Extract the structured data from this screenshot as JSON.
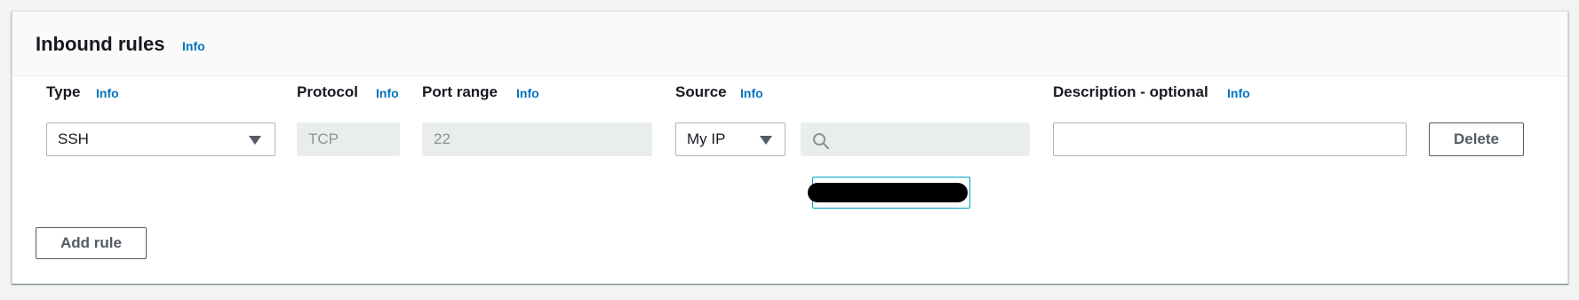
{
  "panel": {
    "title": "Inbound rules",
    "title_info": "Info"
  },
  "columns": {
    "type": {
      "label": "Type",
      "info": "Info"
    },
    "protocol": {
      "label": "Protocol",
      "info": "Info"
    },
    "port_range": {
      "label": "Port range",
      "info": "Info"
    },
    "source": {
      "label": "Source",
      "info": "Info"
    },
    "description": {
      "label": "Description - optional",
      "info": "Info"
    }
  },
  "rule": {
    "type_value": "SSH",
    "protocol_value": "TCP",
    "port_range_value": "22",
    "source_value": "My IP",
    "source_search_value": "",
    "source_chip": "",
    "description_value": ""
  },
  "buttons": {
    "delete": "Delete",
    "add_rule": "Add rule"
  },
  "icons": {
    "type_dropdown": "caret-down-icon",
    "source_dropdown": "caret-down-icon",
    "search": "search-icon"
  },
  "colors": {
    "info_link": "#0073bb",
    "chip_border": "#00a1c9",
    "disabled_field": "#eaeded"
  }
}
